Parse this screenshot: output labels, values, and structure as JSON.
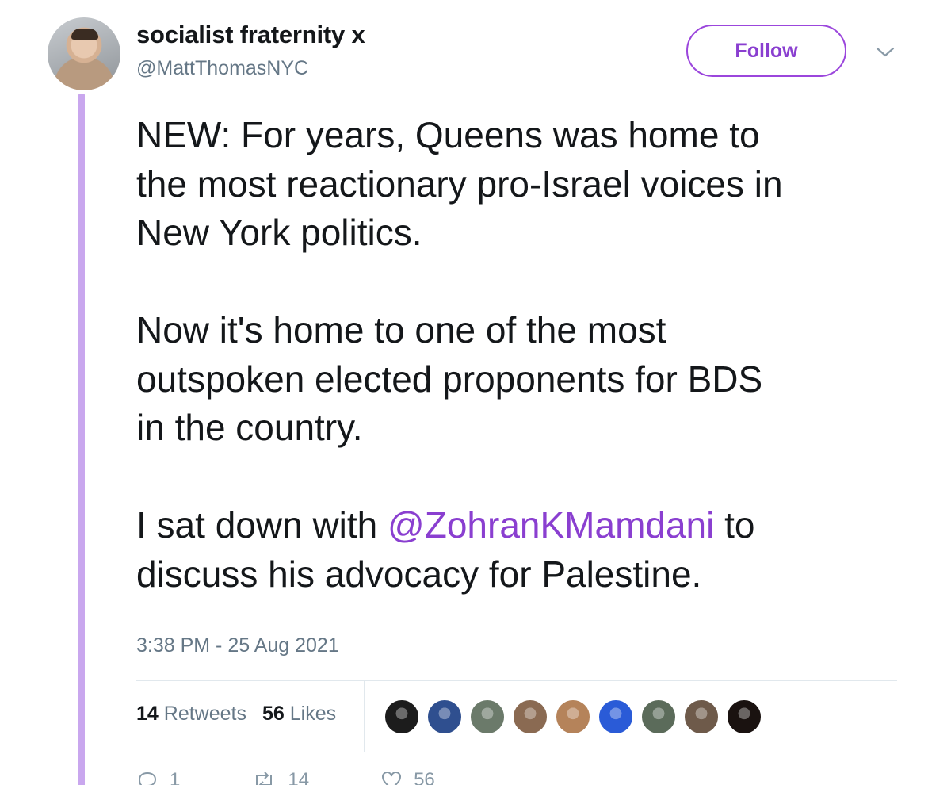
{
  "author": {
    "display_name": "socialist fraternity x",
    "handle": "@MattThomasNYC"
  },
  "follow_label": "Follow",
  "tweet": {
    "p1": "NEW: For years, Queens was home to the most reactionary pro-Israel voices in New York politics.",
    "p1_lines": [
      "NEW: For years, Queens was home to",
      "the most reactionary pro-Israel voices in",
      "New York politics."
    ],
    "p2_lines": [
      "Now it's home to one of the most",
      "outspoken elected proponents for BDS",
      "in the country."
    ],
    "p3_prefix": "I sat down with ",
    "p3_mention": "@ZohranKMamdani",
    "p3_suffix": " to",
    "p3_line2": "discuss his advocacy for Palestine."
  },
  "timestamp": "3:38 PM - 25 Aug 2021",
  "stats": {
    "retweets_count": "14",
    "retweets_label": "Retweets",
    "likes_count": "56",
    "likes_label": "Likes"
  },
  "likers": [
    {
      "icon": "liker-avatar-1",
      "color": "#1c1c1c"
    },
    {
      "icon": "liker-avatar-2",
      "color": "#2f4f8f"
    },
    {
      "icon": "liker-avatar-3",
      "color": "#6b7a6a"
    },
    {
      "icon": "liker-avatar-4",
      "color": "#8a6a52"
    },
    {
      "icon": "liker-avatar-5",
      "color": "#b5835a"
    },
    {
      "icon": "liker-avatar-6",
      "color": "#2a5bd7"
    },
    {
      "icon": "liker-avatar-7",
      "color": "#5b6b5a"
    },
    {
      "icon": "liker-avatar-8",
      "color": "#6e5a4a"
    },
    {
      "icon": "liker-avatar-9",
      "color": "#1a1210"
    }
  ],
  "actions": {
    "reply_count": "1",
    "retweet_count": "14",
    "like_count": "56"
  },
  "colors": {
    "accent": "#8a3fd0",
    "thread_line": "#c9a7ee",
    "muted": "#657786"
  }
}
